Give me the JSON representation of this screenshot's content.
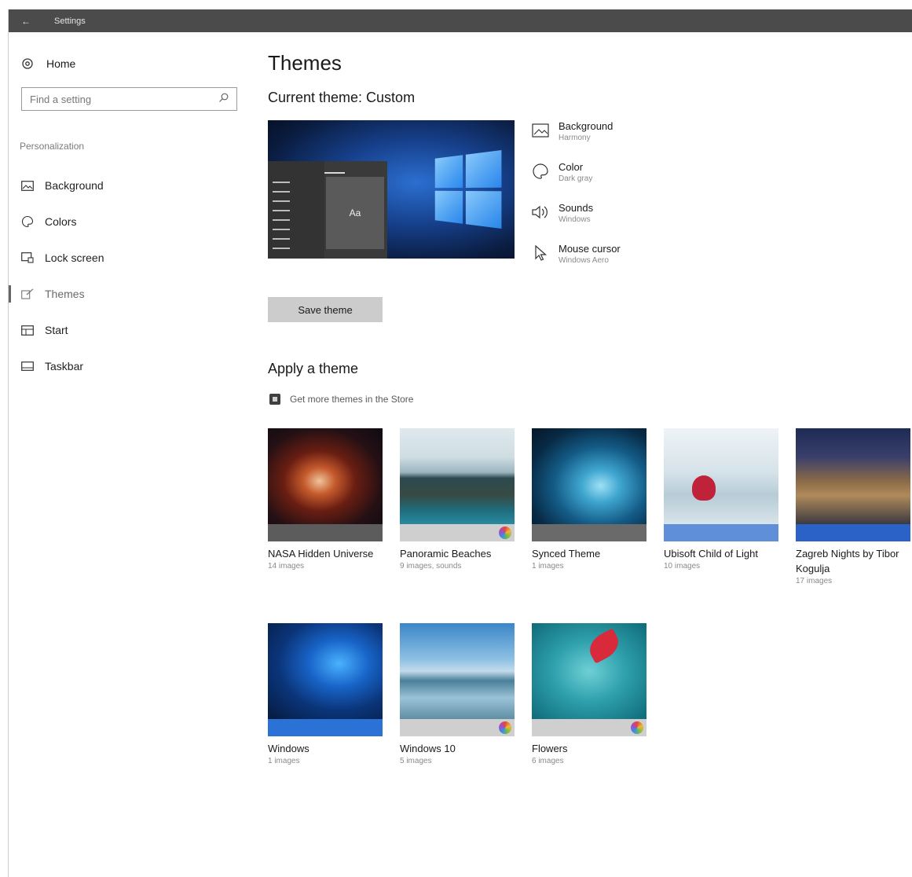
{
  "window": {
    "title": "Settings",
    "back_label": "←"
  },
  "sidebar": {
    "home_label": "Home",
    "search_placeholder": "Find a setting",
    "group_label": "Personalization",
    "items": [
      {
        "label": "Background",
        "icon": "image-icon"
      },
      {
        "label": "Colors",
        "icon": "palette-icon"
      },
      {
        "label": "Lock screen",
        "icon": "lock-screen-icon"
      },
      {
        "label": "Themes",
        "icon": "brush-icon",
        "active": true
      },
      {
        "label": "Start",
        "icon": "start-icon"
      },
      {
        "label": "Taskbar",
        "icon": "taskbar-icon"
      }
    ]
  },
  "main": {
    "title": "Themes",
    "current_theme": "Current theme: Custom",
    "preview_tile": "Aa",
    "properties": [
      {
        "label": "Background",
        "value": "Harmony",
        "icon": "image-icon"
      },
      {
        "label": "Color",
        "value": "Dark gray",
        "icon": "palette-icon"
      },
      {
        "label": "Sounds",
        "value": "Windows",
        "icon": "speaker-icon"
      },
      {
        "label": "Mouse cursor",
        "value": "Windows Aero",
        "icon": "cursor-icon"
      }
    ],
    "save_button": "Save theme",
    "apply_heading": "Apply a theme",
    "store_link": "Get more themes in the Store",
    "themes": [
      {
        "name": "NASA Hidden Universe",
        "count": "14 images",
        "bar_color": "#5c5c5c",
        "badge": false
      },
      {
        "name": "Panoramic Beaches",
        "count": "9 images, sounds",
        "bar_color": "#cfcfcf",
        "badge": true
      },
      {
        "name": "Synced Theme",
        "count": "1 images",
        "bar_color": "#6a6a6a",
        "badge": false
      },
      {
        "name": "Ubisoft Child of Light",
        "count": "10 images",
        "bar_color": "#5f8fd8",
        "badge": false
      },
      {
        "name": "Zagreb Nights by Tibor Kogulja",
        "count": "17 images",
        "bar_color": "#2a62c8",
        "badge": false
      },
      {
        "name": "Windows",
        "count": "1 images",
        "bar_color": "#2a72d6",
        "badge": false
      },
      {
        "name": "Windows 10",
        "count": "5 images",
        "bar_color": "#cfcfcf",
        "badge": true
      },
      {
        "name": "Flowers",
        "count": "6 images",
        "bar_color": "#cfcfcf",
        "badge": true
      }
    ]
  }
}
